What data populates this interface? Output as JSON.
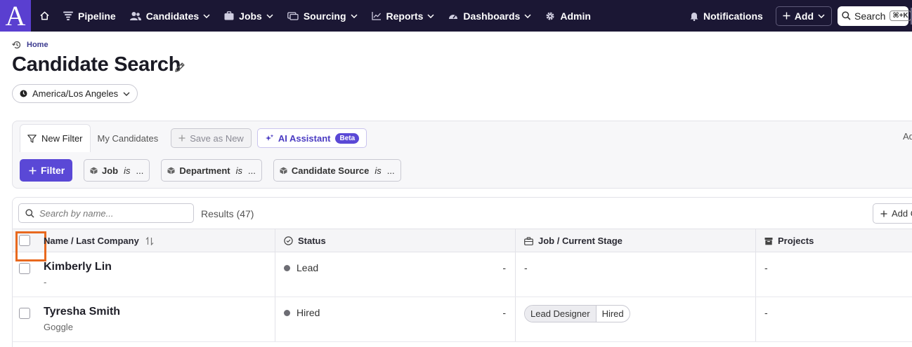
{
  "brand": {
    "logo_letter": "A",
    "accent": "#5a3fd0",
    "nav_bg": "#1b1734"
  },
  "nav": {
    "home_icon": "home-icon",
    "items": [
      {
        "label": "Pipeline",
        "icon": "filter-icon",
        "has_dropdown": false
      },
      {
        "label": "Candidates",
        "icon": "users-icon",
        "has_dropdown": true
      },
      {
        "label": "Jobs",
        "icon": "briefcase-icon",
        "has_dropdown": true
      },
      {
        "label": "Sourcing",
        "icon": "sourcing-icon",
        "has_dropdown": true
      },
      {
        "label": "Reports",
        "icon": "chart-icon",
        "has_dropdown": true
      },
      {
        "label": "Dashboards",
        "icon": "gauge-icon",
        "has_dropdown": true
      },
      {
        "label": "Admin",
        "icon": "gear-icon",
        "has_dropdown": false
      }
    ],
    "notifications_label": "Notifications",
    "add_label": "Add",
    "search_label": "Search",
    "search_shortcut": "⌘+K"
  },
  "header": {
    "breadcrumb": "Home",
    "title": "Candidate Search",
    "timezone": "America/Los Angeles"
  },
  "filter_panel": {
    "tabs": [
      {
        "label": "New Filter",
        "active": true
      },
      {
        "label": "My Candidates",
        "active": false
      }
    ],
    "save_as_new_label": "Save as New",
    "ai_assistant_label": "AI Assistant",
    "ai_badge": "Beta",
    "cut_text": "Ad",
    "filter_button_label": "Filter",
    "filters": [
      {
        "field": "Job",
        "op": "is",
        "value": "..."
      },
      {
        "field": "Department",
        "op": "is",
        "value": "..."
      },
      {
        "field": "Candidate Source",
        "op": "is",
        "value": "..."
      }
    ]
  },
  "results": {
    "search_placeholder": "Search by name...",
    "count_label": "Results (47)",
    "add_column_label": "Add C",
    "columns": [
      {
        "label": "Name / Last Company",
        "icon": "sort-icon"
      },
      {
        "label": "Status",
        "icon": "check-circle-icon"
      },
      {
        "label": "Job / Current Stage",
        "icon": "briefcase-icon"
      },
      {
        "label": "Projects",
        "icon": "archive-icon"
      }
    ],
    "rows": [
      {
        "name": "Kimberly Lin",
        "company": "-",
        "status": "Lead",
        "status_trail": "-",
        "job": "-",
        "stage": "",
        "projects": "-"
      },
      {
        "name": "Tyresha Smith",
        "company": "Goggle",
        "status": "Hired",
        "status_trail": "-",
        "job": "Lead Designer",
        "stage": "Hired",
        "projects": "-"
      }
    ],
    "highlight_color": "#e8691f"
  }
}
